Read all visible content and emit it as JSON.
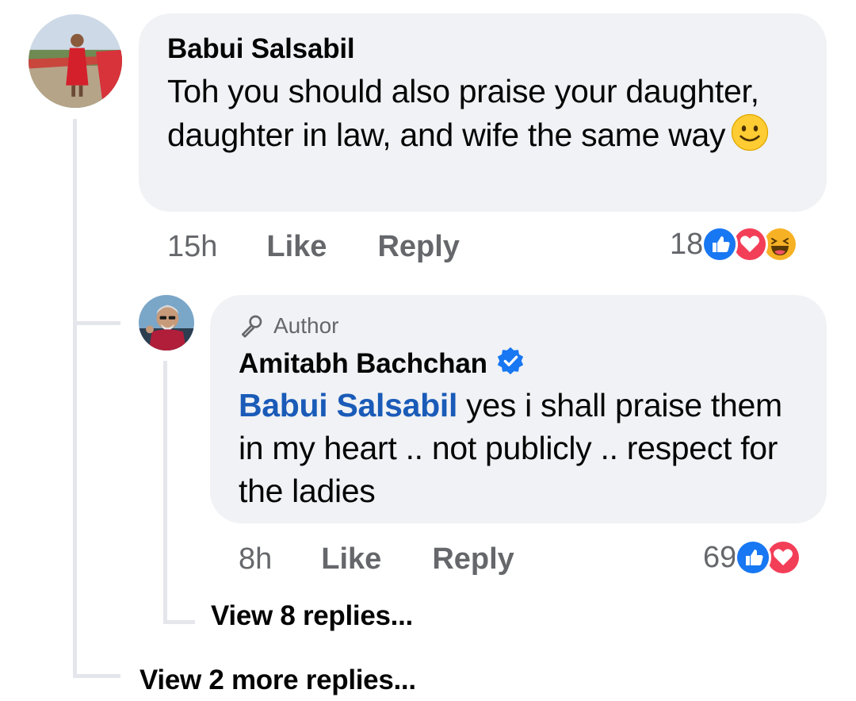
{
  "comment": {
    "author": "Babui Salsabil",
    "text": "Toh you should also praise your daughter, daughter in law, and wife the same way",
    "emoji": "slightly-smiling-face",
    "time": "15h",
    "like_label": "Like",
    "reply_label": "Reply",
    "reaction_count": "18",
    "reactions": [
      "like",
      "love",
      "haha"
    ]
  },
  "reply": {
    "badge": "Author",
    "author": "Amitabh Bachchan",
    "verified": true,
    "mention": "Babui Salsabil",
    "text": " yes i shall praise them in my heart .. not publicly .. respect for the ladies",
    "time": "8h",
    "like_label": "Like",
    "reply_label": "Reply",
    "reaction_count": "69",
    "reactions": [
      "like",
      "love"
    ]
  },
  "view_replies": "View 8 replies...",
  "view_more_replies": "View 2 more replies...",
  "colors": {
    "bubble": "#f0f2f5",
    "meta": "#65676b",
    "mention": "#1a5bb8",
    "like": "#1877f2",
    "love": "#f33e58",
    "haha": "#f7b125",
    "thread_line": "#e4e6eb"
  }
}
